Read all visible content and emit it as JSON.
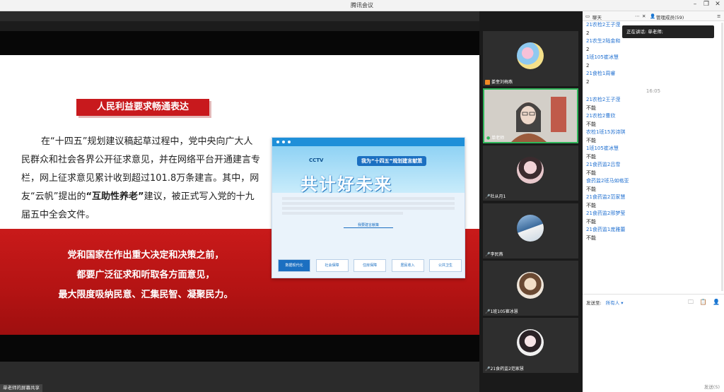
{
  "window": {
    "title": "腾讯会议",
    "controls": [
      "minimize",
      "maximize",
      "close"
    ]
  },
  "slide": {
    "heading": "人民利益要求畅通表达",
    "para_a": "在“十四五”规划建议稿起草过程中，党中央向广大人民群众和社会各界公开征求意见，并在网络平台开通建言专栏，网上征求意见累计收到超过101.8万条建言。其中，网友“云帆”提出的",
    "para_bold": "“互助性养老”",
    "para_b": "建议，被正式写入党的十九届五中全会文件。",
    "quote": [
      "党和国家在作出重大决定和决策之前，",
      "都要广泛征求和听取各方面意见，",
      "最大限度吸纳民意、汇集民智、凝聚民力。"
    ],
    "webimg": {
      "logo": "CCTV",
      "tag": "我为“十四五”规划建言献策",
      "big": "共计好未来",
      "section": "我要建言献策",
      "cats": [
        "数据现代化",
        "社会保障",
        "住房保障",
        "居民收入",
        "公共卫生"
      ]
    }
  },
  "share_label": "单老师的屏幕共享",
  "videos": [
    {
      "name": "娄奎刘梅燕",
      "icon": "person-icon"
    },
    {
      "name": "单老师",
      "icon": "mic-icon"
    },
    {
      "name": "杜从月1",
      "icon": "mic-icon"
    },
    {
      "name": "李民燕",
      "icon": "mic-icon"
    },
    {
      "name": "1班105崔冰慧",
      "icon": "mic-icon"
    },
    {
      "name": "21食药监2范家慧",
      "icon": "mic-icon"
    }
  ],
  "chat": {
    "tab_chat": "聊天",
    "tab_members": "管理成员(59)",
    "speaking_label": "正在讲话: 单老师;",
    "messages": [
      {
        "name": "21农检2王子滢",
        "text": "2"
      },
      {
        "name": "21农生2陆金和",
        "text": "2"
      },
      {
        "name": "1班105崔冰慧",
        "text": "2"
      },
      {
        "name": "21食检1周睿",
        "text": "2"
      },
      {
        "time": "16:05"
      },
      {
        "name": "21农检2王子滢",
        "text": "不能"
      },
      {
        "name": "21农检2曹欣",
        "text": "不能"
      },
      {
        "name": "农检1班15苏诗琪",
        "text": "不能"
      },
      {
        "name": "1班105崔冰慧",
        "text": "不能"
      },
      {
        "name": "21食药监2吕雪",
        "text": "不能"
      },
      {
        "name": "食药监2班马如格亚",
        "text": "不能"
      },
      {
        "name": "21食药监2范家慧",
        "text": "不能"
      },
      {
        "name": "21食药监2邢梦莹",
        "text": "不能"
      },
      {
        "name": "21食药监1庞雅蕾",
        "text": "不能"
      }
    ],
    "send_to_label": "发送至:",
    "send_to_value": "所有人",
    "send_button": "发送(S)"
  }
}
